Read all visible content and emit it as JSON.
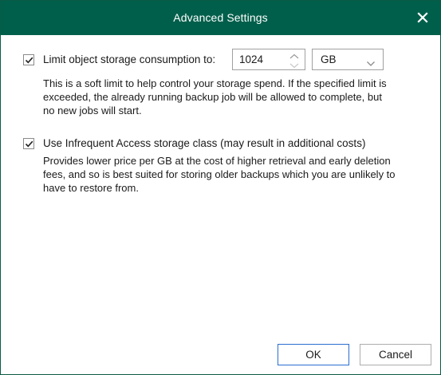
{
  "dialog": {
    "title": "Advanced Settings",
    "close_icon": "close-icon",
    "title_bar_color": "#005f4b"
  },
  "storage_limit": {
    "checked": true,
    "label": "Limit object storage consumption to:",
    "value": "1024",
    "unit": "GB",
    "description": [
      "This is a soft limit to help control your storage spend. If the specified limit is",
      "exceeded, the already running backup job will be allowed to complete, but",
      "no new jobs will start."
    ]
  },
  "infrequent_access": {
    "checked": true,
    "label": "Use Infrequent Access storage class (may result in additional costs)",
    "description": [
      "Provides lower price per GB at the cost of higher retrieval and early deletion",
      "fees, and so is best suited for storing older backups which you are unlikely to",
      "have to restore from."
    ]
  },
  "buttons": {
    "ok": "OK",
    "cancel": "Cancel"
  }
}
